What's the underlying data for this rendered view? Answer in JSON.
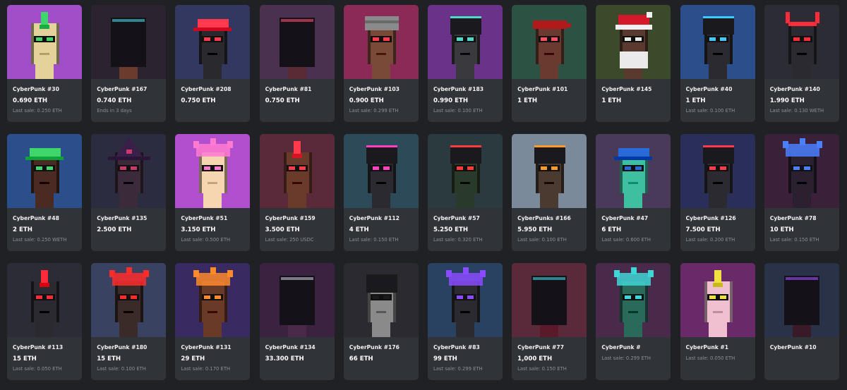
{
  "items": [
    {
      "name": "CyberPunk #30",
      "price": "0.690 ETH",
      "sub": "Last sale: 0.250 ETH",
      "bg": "#a04fc8",
      "skin": "#e3d29a",
      "accent": "#3ed66b",
      "head": "mohawk"
    },
    {
      "name": "CyberPunk #167",
      "price": "0.740 ETH",
      "sub": "Ends in 3 days",
      "bg": "#2b2430",
      "skin": "#6b3b2e",
      "accent": "#3fd0e0",
      "head": "hood"
    },
    {
      "name": "CyberPunk #208",
      "price": "0.750 ETH",
      "sub": "",
      "bg": "#333860",
      "skin": "#2a2a2e",
      "accent": "#ff3a4f",
      "head": "cap"
    },
    {
      "name": "CyberPunk #81",
      "price": "0.750 ETH",
      "sub": "",
      "bg": "#4a3150",
      "skin": "#5a2a35",
      "accent": "#ff4a6a",
      "head": "hood"
    },
    {
      "name": "CyberPunk #103",
      "price": "0.900 ETH",
      "sub": "Last sale: 0.299 ETH",
      "bg": "#8c2a57",
      "skin": "#7a4a38",
      "accent": "#ff3a4a",
      "head": "turban"
    },
    {
      "name": "CyberPunk #183",
      "price": "0.990 ETH",
      "sub": "Last sale: 0.100 ETH",
      "bg": "#6a3288",
      "skin": "#3a3a3e",
      "accent": "#50d8c8",
      "head": "helmet"
    },
    {
      "name": "CyberPunk #101",
      "price": "1 ETH",
      "sub": "",
      "bg": "#2c5244",
      "skin": "#6a3a30",
      "accent": "#ff5060",
      "head": "bandana"
    },
    {
      "name": "CyberPunk #145",
      "price": "1 ETH",
      "sub": "",
      "bg": "#3a4a2a",
      "skin": "#5a3a2e",
      "accent": "#e8e8e8",
      "head": "santa"
    },
    {
      "name": "CyberPunk #40",
      "price": "1 ETH",
      "sub": "Last sale: 0.100 ETH",
      "bg": "#2a4f8a",
      "skin": "#2a2a30",
      "accent": "#40c8ff",
      "head": "helmet"
    },
    {
      "name": "CyberPunk #140",
      "price": "1.990 ETH",
      "sub": "Last sale: 0.130 WETH",
      "bg": "#2c2c34",
      "skin": "#2a2a30",
      "accent": "#ff2a3a",
      "head": "horns"
    },
    {
      "name": "CyberPunk #48",
      "price": "2 ETH",
      "sub": "Last sale: 0.250 WETH",
      "bg": "#2a4f8a",
      "skin": "#4a2a22",
      "accent": "#3ed66b",
      "head": "cap"
    },
    {
      "name": "CyberPunk #135",
      "price": "2.500 ETH",
      "sub": "",
      "bg": "#2c2c40",
      "skin": "#3a2a3a",
      "accent": "#c83a6a",
      "head": "witch"
    },
    {
      "name": "CyberPunk #51",
      "price": "3.150 ETH",
      "sub": "Last sale: 0.500 ETH",
      "bg": "#b24fcf",
      "skin": "#f5d6b0",
      "accent": "#ff7ad0",
      "head": "wild"
    },
    {
      "name": "CyberPunk #159",
      "price": "3.500 ETH",
      "sub": "Last sale: 250 USDC",
      "bg": "#5a2a3a",
      "skin": "#6a3a2a",
      "accent": "#ff3a4a",
      "head": "mohawk"
    },
    {
      "name": "CyberPunk #112",
      "price": "4 ETH",
      "sub": "Last sale: 0.150 ETH",
      "bg": "#2c4a58",
      "skin": "#2a2a30",
      "accent": "#ff40c0",
      "head": "helmet"
    },
    {
      "name": "CyberPunk #57",
      "price": "5.250 ETH",
      "sub": "Last sale: 0.320 ETH",
      "bg": "#2a3a3e",
      "skin": "#2a3a2a",
      "accent": "#ff3a3a",
      "head": "helmet"
    },
    {
      "name": "CyberPunks #166",
      "price": "5.950 ETH",
      "sub": "Last sale: 0.100 ETH",
      "bg": "#7a8a9a",
      "skin": "#4a3a30",
      "accent": "#ff9a2a",
      "head": "helmet"
    },
    {
      "name": "CyberPunk #47",
      "price": "6 ETH",
      "sub": "Last sale: 0.600 ETH",
      "bg": "#4a3a5a",
      "skin": "#3ec0a0",
      "accent": "#2a6ad8",
      "head": "cap"
    },
    {
      "name": "CyberPunk #126",
      "price": "7.500 ETH",
      "sub": "Last sale: 0.200 ETH",
      "bg": "#2a2f5a",
      "skin": "#2a2a30",
      "accent": "#ff3a4a",
      "head": "helmet"
    },
    {
      "name": "CyberPunk #78",
      "price": "10 ETH",
      "sub": "Last sale: 0.150 ETH",
      "bg": "#3a2038",
      "skin": "#2a2030",
      "accent": "#4a80ff",
      "head": "wild"
    },
    {
      "name": "CyberPunk #113",
      "price": "15 ETH",
      "sub": "Last sale: 0.050 ETH",
      "bg": "#2c2c36",
      "skin": "#2a2a30",
      "accent": "#ff2a3a",
      "head": "mohawk"
    },
    {
      "name": "CyberPunk #180",
      "price": "15 ETH",
      "sub": "Last sale: 0.100 ETH",
      "bg": "#3a4262",
      "skin": "#3a2a28",
      "accent": "#ff2a2a",
      "head": "wild"
    },
    {
      "name": "CyberPunk #131",
      "price": "29 ETH",
      "sub": "Last sale: 0.170 ETH",
      "bg": "#3a2a62",
      "skin": "#6a3a28",
      "accent": "#ff8a2a",
      "head": "wild"
    },
    {
      "name": "CyberPunk #134",
      "price": "33.300 ETH",
      "sub": "",
      "bg": "#3a2240",
      "skin": "#4a2a4a",
      "accent": "#c0c0d0",
      "head": "hood"
    },
    {
      "name": "CyberPunk #176",
      "price": "66 ETH",
      "sub": "",
      "bg": "#2a2a30",
      "skin": "#8a8a8a",
      "accent": "#1a1a1a",
      "head": "helmet"
    },
    {
      "name": "CyberPunk #83",
      "price": "99 ETH",
      "sub": "Last sale: 0.299 ETH",
      "bg": "#2a4262",
      "skin": "#2a2a30",
      "accent": "#8a4aff",
      "head": "wild"
    },
    {
      "name": "CyberPunk #77",
      "price": "1,000 ETH",
      "sub": "Last sale: 0.150 ETH",
      "bg": "#5a2a3a",
      "skin": "#5a1a2a",
      "accent": "#3fd0e0",
      "head": "hood"
    },
    {
      "name": "CyberPunk #",
      "price": "",
      "sub": "Last sale: 0.299 ETH",
      "bg": "#4a2a4a",
      "skin": "#2a6a5a",
      "accent": "#3ed6d6",
      "head": "wild"
    },
    {
      "name": "CyberPunk #1",
      "price": "",
      "sub": "Last sale: 0.050 ETH",
      "bg": "#6a2a6a",
      "skin": "#f0c0d0",
      "accent": "#f0e040",
      "head": "mohawk"
    },
    {
      "name": "CyberPunk #10",
      "price": "",
      "sub": "",
      "bg": "#2a3248",
      "skin": "#3a1a28",
      "accent": "#a04aff",
      "head": "hood"
    }
  ]
}
